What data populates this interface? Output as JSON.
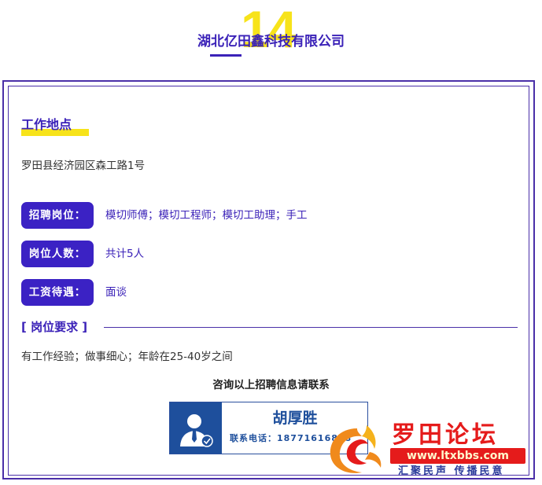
{
  "header": {
    "number": "14",
    "company": "湖北亿田鑫科技有限公司"
  },
  "work_location": {
    "title": "工作地点",
    "address": "罗田县经济园区森工路1号"
  },
  "fields": [
    {
      "label": "招聘岗位：",
      "value": "模切师傅；模切工程师；模切工助理；手工"
    },
    {
      "label": "岗位人数：",
      "value": "共计5人"
    },
    {
      "label": "工资待遇：",
      "value": "面谈"
    }
  ],
  "requirements": {
    "title": "[ 岗位要求 ]",
    "text": "有工作经验；做事细心；年龄在25-40岁之间"
  },
  "contact": {
    "prompt": "咨询以上招聘信息请联系",
    "name": "胡厚胜",
    "phone": "联系电话：18771616868"
  },
  "watermark": {
    "name": "罗田论坛",
    "url": "www.ltxbbs.com",
    "slogan": "汇聚民声 传播民意"
  },
  "colors": {
    "accent": "#3b22c4",
    "highlight": "#f7e31a",
    "card_blue": "#1e4f9c",
    "logo_red": "#e51b1b"
  }
}
